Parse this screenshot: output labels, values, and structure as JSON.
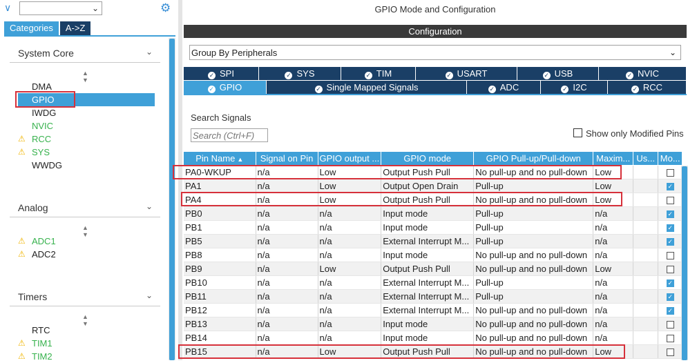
{
  "left": {
    "filter_icon": "chevron-down-icon",
    "settings_icon": "gear-icon",
    "tabs": {
      "categories": "Categories",
      "az": "A->Z"
    },
    "system_core": {
      "title": "System Core",
      "items": [
        {
          "label": "DMA",
          "state": "normal"
        },
        {
          "label": "GPIO",
          "state": "selected"
        },
        {
          "label": "IWDG",
          "state": "normal"
        },
        {
          "label": "NVIC",
          "state": "configured"
        },
        {
          "label": "RCC",
          "state": "warning"
        },
        {
          "label": "SYS",
          "state": "warning"
        },
        {
          "label": "WWDG",
          "state": "normal"
        }
      ]
    },
    "analog": {
      "title": "Analog",
      "items": [
        {
          "label": "ADC1",
          "state": "warning"
        },
        {
          "label": "ADC2",
          "state": "warning-dark"
        }
      ]
    },
    "timers": {
      "title": "Timers",
      "items": [
        {
          "label": "RTC",
          "state": "normal"
        },
        {
          "label": "TIM1",
          "state": "warning"
        },
        {
          "label": "TIM2",
          "state": "warning"
        }
      ]
    }
  },
  "right": {
    "title": "GPIO Mode and Configuration",
    "config_header": "Configuration",
    "group_by": "Group By Peripherals",
    "peripheral_tabs_row1": [
      "SPI",
      "SYS",
      "TIM",
      "USART",
      "USB",
      "NVIC"
    ],
    "peripheral_tabs_row2": [
      "GPIO",
      "Single Mapped Signals",
      "ADC",
      "I2C",
      "RCC"
    ],
    "active_tab": "GPIO",
    "search_label": "Search Signals",
    "search_placeholder": "Search (Ctrl+F)",
    "show_only_modified": "Show only Modified Pins",
    "columns": [
      "Pin Name",
      "Signal on Pin",
      "GPIO output ...",
      "GPIO mode",
      "GPIO Pull-up/Pull-down",
      "Maxim...",
      "Us...",
      "Mo..."
    ],
    "rows": [
      {
        "pin": "PA0-WKUP",
        "signal": "n/a",
        "output": "Low",
        "mode": "Output Push Pull",
        "pull": "No pull-up and no pull-down",
        "max": "Low",
        "user": "",
        "modified": false
      },
      {
        "pin": "PA1",
        "signal": "n/a",
        "output": "Low",
        "mode": "Output Open Drain",
        "pull": "Pull-up",
        "max": "Low",
        "user": "",
        "modified": true
      },
      {
        "pin": "PA4",
        "signal": "n/a",
        "output": "Low",
        "mode": "Output Push Pull",
        "pull": "No pull-up and no pull-down",
        "max": "Low",
        "user": "",
        "modified": false
      },
      {
        "pin": "PB0",
        "signal": "n/a",
        "output": "n/a",
        "mode": "Input mode",
        "pull": "Pull-up",
        "max": "n/a",
        "user": "",
        "modified": true
      },
      {
        "pin": "PB1",
        "signal": "n/a",
        "output": "n/a",
        "mode": "Input mode",
        "pull": "Pull-up",
        "max": "n/a",
        "user": "",
        "modified": true
      },
      {
        "pin": "PB5",
        "signal": "n/a",
        "output": "n/a",
        "mode": "External Interrupt M...",
        "pull": "Pull-up",
        "max": "n/a",
        "user": "",
        "modified": true
      },
      {
        "pin": "PB8",
        "signal": "n/a",
        "output": "n/a",
        "mode": "Input mode",
        "pull": "No pull-up and no pull-down",
        "max": "n/a",
        "user": "",
        "modified": false
      },
      {
        "pin": "PB9",
        "signal": "n/a",
        "output": "Low",
        "mode": "Output Push Pull",
        "pull": "No pull-up and no pull-down",
        "max": "Low",
        "user": "",
        "modified": false
      },
      {
        "pin": "PB10",
        "signal": "n/a",
        "output": "n/a",
        "mode": "External Interrupt M...",
        "pull": "Pull-up",
        "max": "n/a",
        "user": "",
        "modified": true
      },
      {
        "pin": "PB11",
        "signal": "n/a",
        "output": "n/a",
        "mode": "External Interrupt M...",
        "pull": "Pull-up",
        "max": "n/a",
        "user": "",
        "modified": true
      },
      {
        "pin": "PB12",
        "signal": "n/a",
        "output": "n/a",
        "mode": "External Interrupt M...",
        "pull": "No pull-up and no pull-down",
        "max": "n/a",
        "user": "",
        "modified": true
      },
      {
        "pin": "PB13",
        "signal": "n/a",
        "output": "n/a",
        "mode": "Input mode",
        "pull": "No pull-up and no pull-down",
        "max": "n/a",
        "user": "",
        "modified": false
      },
      {
        "pin": "PB14",
        "signal": "n/a",
        "output": "n/a",
        "mode": "Input mode",
        "pull": "No pull-up and no pull-down",
        "max": "n/a",
        "user": "",
        "modified": false
      },
      {
        "pin": "PB15",
        "signal": "n/a",
        "output": "Low",
        "mode": "Output Push Pull",
        "pull": "No pull-up and no pull-down",
        "max": "Low",
        "user": "",
        "modified": false
      }
    ]
  },
  "colors": {
    "accent": "#3fa0d8",
    "dark_tab": "#1a3f66",
    "configured_green": "#37b24d",
    "warning_yellow": "#f0b400",
    "highlight_red": "#d6303a"
  }
}
